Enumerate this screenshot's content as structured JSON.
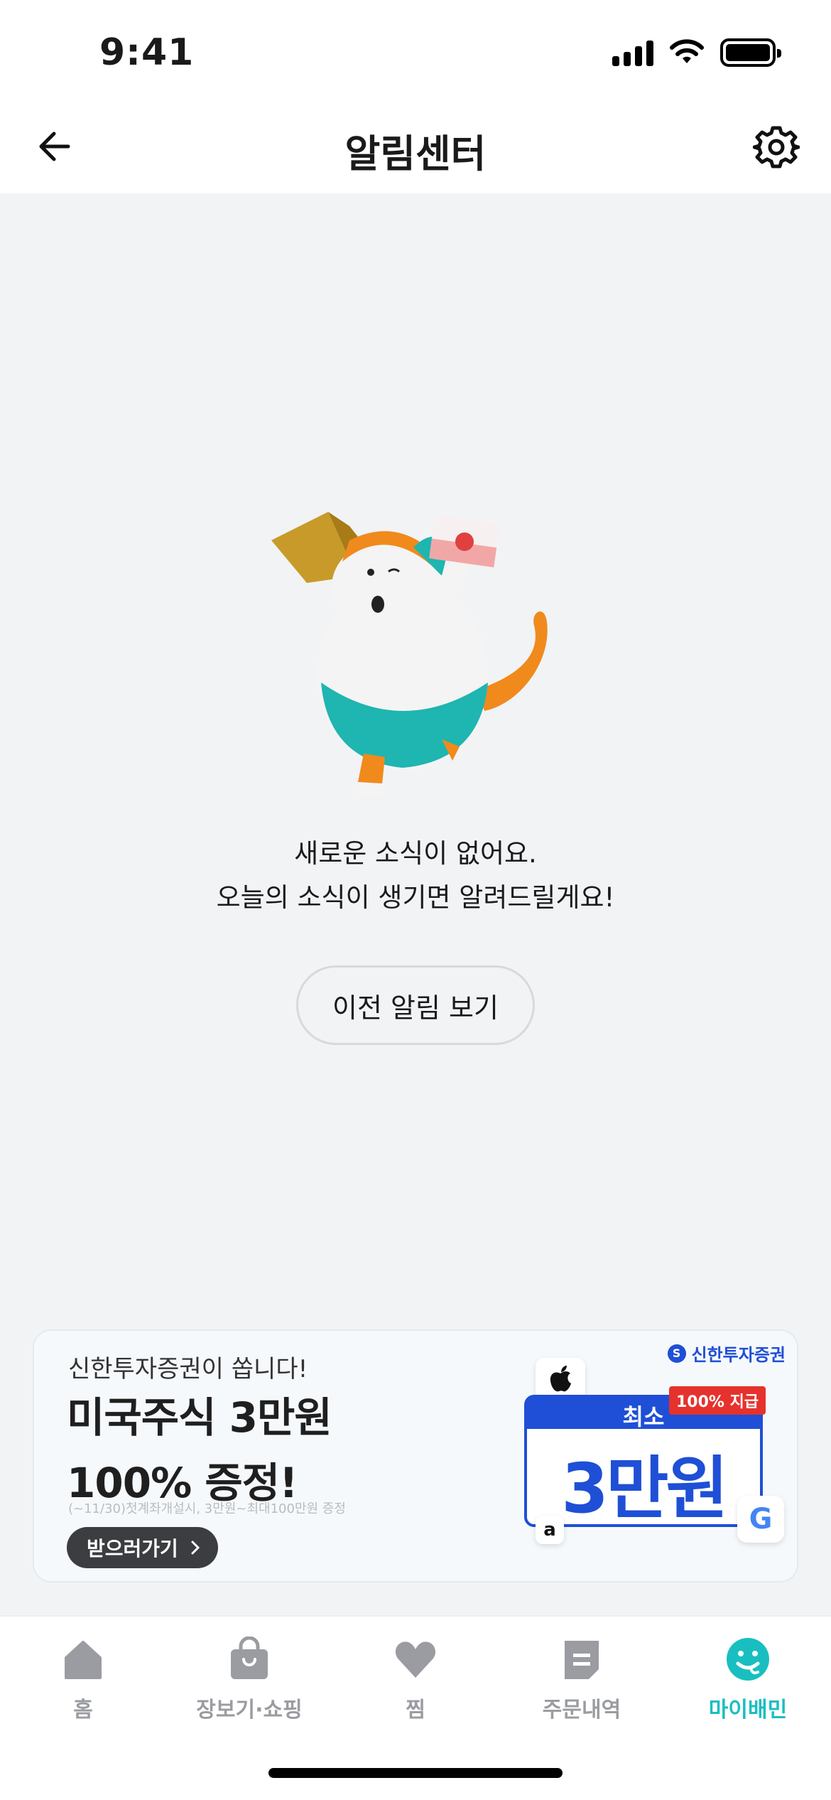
{
  "status_bar": {
    "time": "9:41"
  },
  "header": {
    "title": "알림센터"
  },
  "empty_state": {
    "line1": "새로운 소식이 없어요.",
    "line2": "오늘의 소식이 생기면 알려드릴게요!",
    "button_label": "이전 알림 보기"
  },
  "ad": {
    "sub": "신한투자증권이 쏩니다!",
    "headline_line1": "미국주식 3만원",
    "headline_line2": "100% 증정!",
    "fine_print": "(~11/30)첫계좌개설시, 3만원~최대100만원 증정",
    "cta_label": "받으러가기",
    "brand": "신한투자증권",
    "badge": "100% 지급",
    "card_min": "최소",
    "card_amount": "3만원"
  },
  "tabbar": {
    "items": [
      {
        "label": "홈",
        "icon": "home-icon"
      },
      {
        "label": "장보기·쇼핑",
        "icon": "shopping-bag-icon"
      },
      {
        "label": "찜",
        "icon": "heart-icon"
      },
      {
        "label": "주문내역",
        "icon": "receipt-icon"
      },
      {
        "label": "마이배민",
        "icon": "smile-icon"
      }
    ],
    "active_index": 4
  },
  "colors": {
    "accent": "#19BFC0",
    "tab_inactive": "#9a9ca1",
    "ad_blue": "#1f4fd6",
    "background": "#F2F3F5"
  }
}
